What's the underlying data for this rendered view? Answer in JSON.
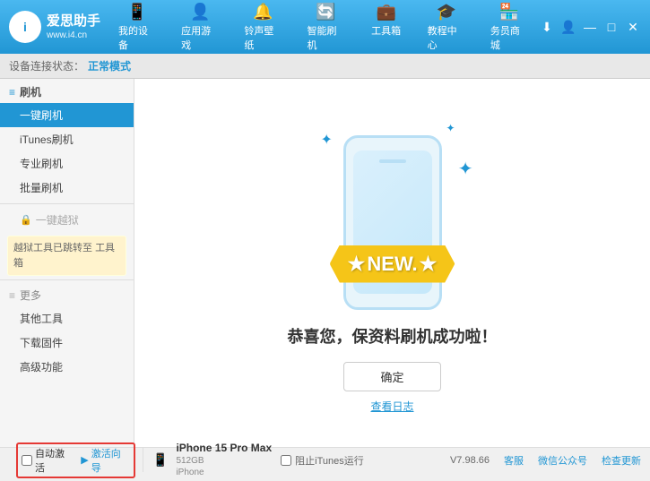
{
  "app": {
    "logo_main": "爱思助手",
    "logo_sub": "www.i4.cn",
    "logo_letter": "i"
  },
  "nav": {
    "tabs": [
      {
        "id": "my-device",
        "icon": "📱",
        "label": "我的设备"
      },
      {
        "id": "apps",
        "icon": "👤",
        "label": "应用游戏"
      },
      {
        "id": "ringtones",
        "icon": "🔔",
        "label": "铃声壁纸"
      },
      {
        "id": "smart-flash",
        "icon": "🔄",
        "label": "智能刷机"
      },
      {
        "id": "toolbox",
        "icon": "💼",
        "label": "工具箱"
      },
      {
        "id": "tutorials",
        "icon": "🎓",
        "label": "教程中心"
      },
      {
        "id": "store",
        "icon": "🏪",
        "label": "务员商城"
      }
    ]
  },
  "toolbar": {
    "label": "设备连接状态：",
    "status": "正常模式"
  },
  "sidebar": {
    "section_flash": "刷机",
    "items": [
      {
        "id": "one-click-flash",
        "label": "一键刷机",
        "active": true
      },
      {
        "id": "itunes-flash",
        "label": "iTunes刷机"
      },
      {
        "id": "pro-flash",
        "label": "专业刷机"
      },
      {
        "id": "batch-flash",
        "label": "批量刷机"
      }
    ],
    "section_disabled_label": "一键越狱",
    "notice_line1": "越狱工具已跳转至",
    "notice_line2": "工具箱",
    "section_more": "更多",
    "more_items": [
      {
        "id": "other-tools",
        "label": "其他工具"
      },
      {
        "id": "download-firmware",
        "label": "下载固件"
      },
      {
        "id": "advanced",
        "label": "高级功能"
      }
    ]
  },
  "content": {
    "success_message": "恭喜您，保资料刷机成功啦！",
    "confirm_label": "确定",
    "log_label": "查看日志",
    "ribbon_text": "NEW.",
    "ribbon_star_left": "★",
    "ribbon_star_right": "★"
  },
  "bottom": {
    "auto_activate_label": "自动激活",
    "guide_label": "激活向导",
    "device_name": "iPhone 15 Pro Max",
    "device_storage": "512GB",
    "device_type": "iPhone",
    "version": "V7.98.66",
    "links": [
      "客服",
      "微信公众号",
      "检查更新"
    ],
    "stop_itunes_label": "阻止iTunes运行"
  },
  "header_icons": {
    "download": "⬇",
    "user": "👤",
    "minimize": "—",
    "maximize": "□",
    "close": "✕"
  }
}
